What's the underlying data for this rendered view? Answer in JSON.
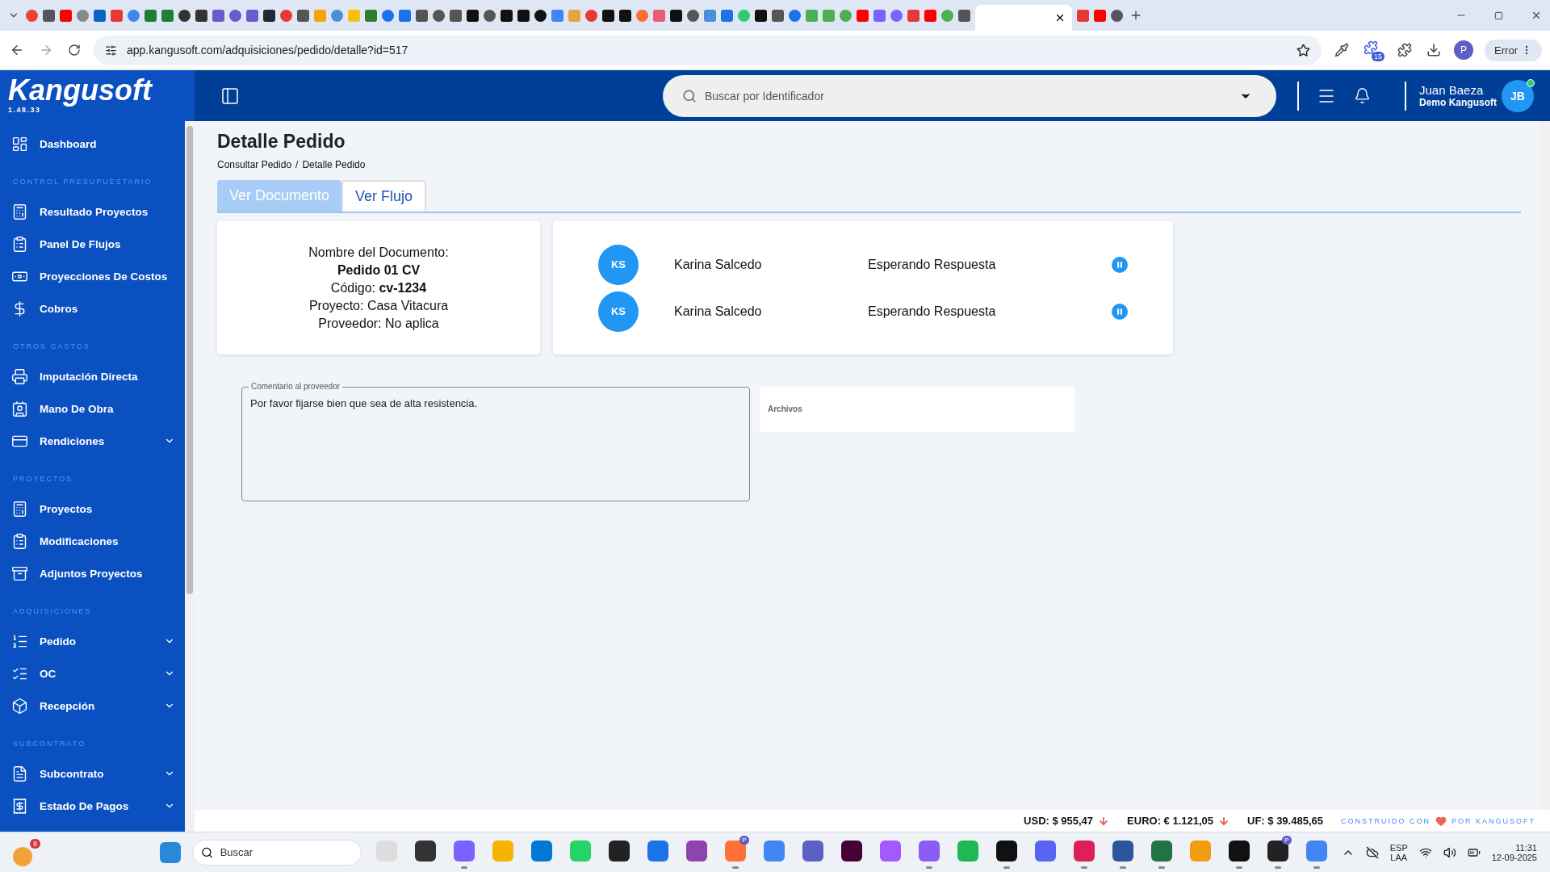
{
  "browser": {
    "address": "app.kangusoft.com/adquisiciones/pedido/detalle?id=517",
    "extension_badge": "15",
    "profile_initial": "P",
    "error_label": "Error"
  },
  "sidebar": {
    "logo": "Kangusoft",
    "version": "1.48.33",
    "sections": [
      {
        "items": [
          {
            "label": "Dashboard",
            "expandable": false
          }
        ]
      },
      {
        "heading": "CONTROL PRESUPUESTARIO",
        "items": [
          {
            "label": "Resultado Proyectos",
            "expandable": false
          },
          {
            "label": "Panel De Flujos",
            "expandable": false
          },
          {
            "label": "Proyecciones De Costos",
            "expandable": false
          },
          {
            "label": "Cobros",
            "expandable": false
          }
        ]
      },
      {
        "heading": "OTROS GASTOS",
        "items": [
          {
            "label": "Imputación Directa",
            "expandable": false
          },
          {
            "label": "Mano De Obra",
            "expandable": false
          },
          {
            "label": "Rendiciones",
            "expandable": true
          }
        ]
      },
      {
        "heading": "PROYECTOS",
        "items": [
          {
            "label": "Proyectos",
            "expandable": false
          },
          {
            "label": "Modificaciones",
            "expandable": false
          },
          {
            "label": "Adjuntos Proyectos",
            "expandable": false
          }
        ]
      },
      {
        "heading": "ADQUISICIONES",
        "items": [
          {
            "label": "Pedido",
            "expandable": true
          },
          {
            "label": "OC",
            "expandable": true
          },
          {
            "label": "Recepción",
            "expandable": true
          }
        ]
      },
      {
        "heading": "SUBCONTRATO",
        "items": [
          {
            "label": "Subcontrato",
            "expandable": true
          },
          {
            "label": "Estado De Pagos",
            "expandable": true
          }
        ]
      }
    ]
  },
  "header": {
    "search_placeholder": "Buscar por Identificador",
    "user_name": "Juan Baeza",
    "company": "Demo Kangusoft",
    "avatar_initials": "JB",
    "online": true
  },
  "page": {
    "title": "Detalle Pedido",
    "breadcrumb": [
      "Consultar Pedido",
      "Detalle Pedido"
    ],
    "breadcrumb_separator": "/",
    "tabs": [
      {
        "label": "Ver Documento",
        "selected": false
      },
      {
        "label": "Ver Flujo",
        "selected": true
      }
    ],
    "document": {
      "name_label": "Nombre del Documento:",
      "name": "Pedido 01 CV",
      "lines": [
        "Código: **cv-1234**",
        "Proyecto: Casa Vitacura",
        "Proveedor: No aplica"
      ]
    },
    "flow": [
      {
        "initials": "KS",
        "name": "Karina Salcedo",
        "status": "Esperando Respuesta",
        "kind": "pending"
      },
      {
        "initials": "KS",
        "name": "Karina Salcedo",
        "status": "Esperando Respuesta",
        "kind": "pending"
      }
    ],
    "comment": {
      "label": "Comentario al proveedor",
      "value": "Por favor fijarse bien que sea de alta resistencia."
    },
    "attachments": {
      "label": "Archivos"
    }
  },
  "footer": {
    "rates": [
      {
        "label": "USD: $ 955,47",
        "falling": true
      },
      {
        "label": "EURO: € 1.121,05",
        "falling": true
      },
      {
        "label": "UF: $ 39.485,65",
        "falling": false
      }
    ],
    "credit_before": "CONSTRUIDO CON",
    "credit_after": "POR KANGUSOFT"
  },
  "taskbar": {
    "notification_badge": "8",
    "search_placeholder": "Buscar",
    "apps": [
      {
        "running": false
      },
      {
        "running": false
      },
      {
        "running": true
      },
      {
        "running": false
      },
      {
        "running": false
      },
      {
        "running": false
      },
      {
        "running": false
      },
      {
        "running": false
      },
      {
        "running": false
      },
      {
        "running": true,
        "badge": "P"
      },
      {
        "running": false
      },
      {
        "running": false
      },
      {
        "running": false
      },
      {
        "running": false
      },
      {
        "running": true
      },
      {
        "running": false
      },
      {
        "running": true
      },
      {
        "running": false
      },
      {
        "running": true
      },
      {
        "running": true
      },
      {
        "running": true
      },
      {
        "running": false
      },
      {
        "running": true
      },
      {
        "running": true,
        "badge": "P"
      },
      {
        "running": true
      }
    ],
    "language": "ESP",
    "layout": "LAA",
    "time": "11:31",
    "date": "12-09-2025"
  }
}
